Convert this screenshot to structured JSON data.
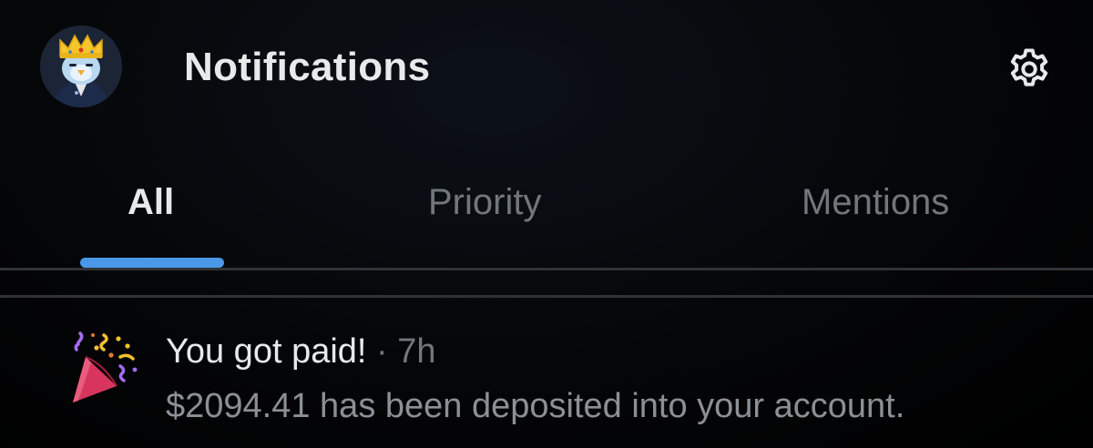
{
  "header": {
    "title": "Notifications",
    "settings_icon": "gear-icon",
    "avatar_icon": "crowned-bird-avatar"
  },
  "tabs": [
    {
      "label": "All",
      "selected": true
    },
    {
      "label": "Priority",
      "selected": false
    },
    {
      "label": "Mentions",
      "selected": false
    }
  ],
  "notifications": [
    {
      "icon": "party-popper-icon",
      "title": "You got paid!",
      "separator": "·",
      "time": "7h",
      "body": "$2094.41 has been deposited into your account."
    }
  ],
  "colors": {
    "accent": "#4a99e9",
    "text_primary": "#e7e9ea",
    "text_secondary": "#71767b",
    "divider": "#2f3336",
    "background": "#000000"
  }
}
